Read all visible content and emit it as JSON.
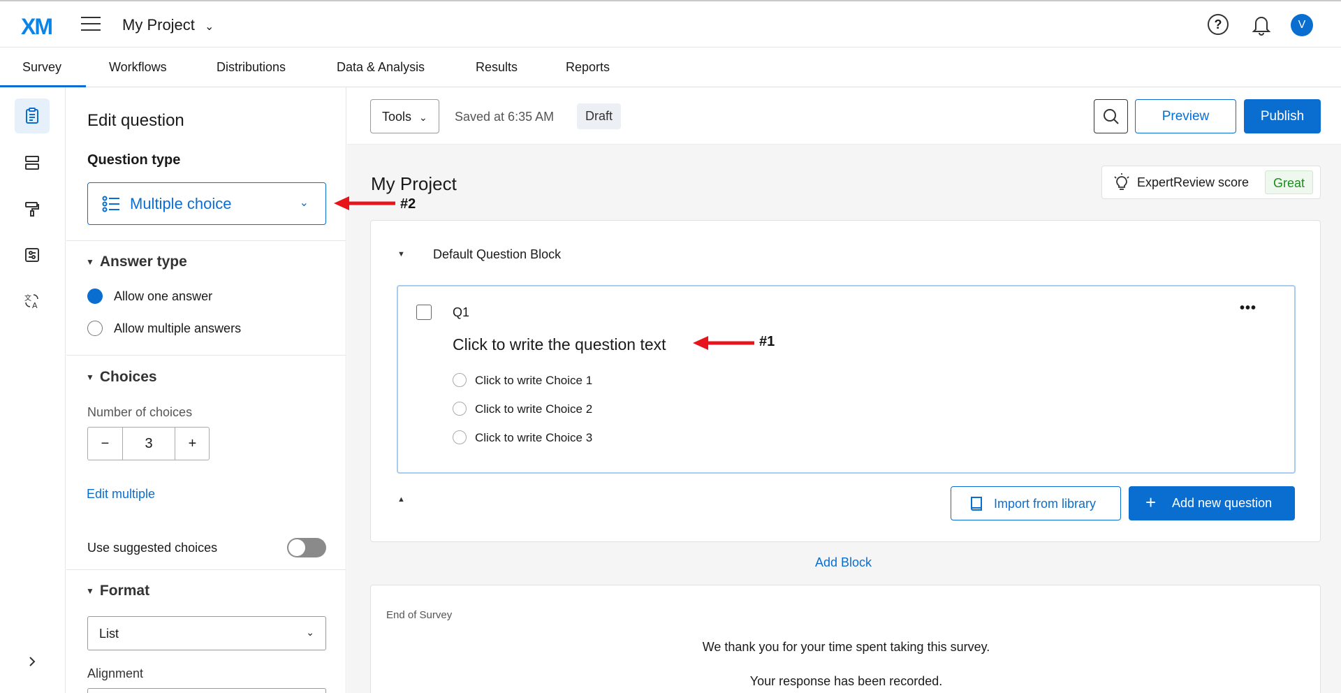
{
  "header": {
    "logo": "XM",
    "project_title": "My Project",
    "avatar_initial": "V"
  },
  "tabs": [
    "Survey",
    "Workflows",
    "Distributions",
    "Data & Analysis",
    "Results",
    "Reports"
  ],
  "editor": {
    "panel_title": "Edit question",
    "question_type_label": "Question type",
    "question_type_value": "Multiple choice",
    "answer_type_heading": "Answer type",
    "answer_options": [
      "Allow one answer",
      "Allow multiple answers"
    ],
    "choices_heading": "Choices",
    "number_of_choices_label": "Number of choices",
    "number_of_choices_value": "3",
    "edit_multiple": "Edit multiple",
    "use_suggested_choices": "Use suggested choices",
    "format_heading": "Format",
    "format_value": "List",
    "alignment_label": "Alignment"
  },
  "toolbar": {
    "tools_label": "Tools",
    "saved_text": "Saved at 6:35 AM",
    "draft_badge": "Draft",
    "preview_label": "Preview",
    "publish_label": "Publish"
  },
  "survey": {
    "title": "My Project",
    "expert_review_label": "ExpertReview score",
    "expert_review_score": "Great",
    "block_title": "Default Question Block",
    "question_number": "Q1",
    "question_text": "Click to write the question text",
    "choices": [
      "Click to write Choice 1",
      "Click to write Choice 2",
      "Click to write Choice 3"
    ],
    "import_label": "Import from library",
    "add_question_label": "Add new question",
    "add_block_label": "Add Block",
    "end_of_survey_label": "End of Survey",
    "end_text_1": "We thank you for your time spent taking this survey.",
    "end_text_2": "Your response has been recorded."
  },
  "annotations": [
    "#1",
    "#2"
  ],
  "colors": {
    "accent": "#0a6ed1",
    "annotation_arrow": "#e8141b",
    "score_green": "#1e8a1e"
  }
}
